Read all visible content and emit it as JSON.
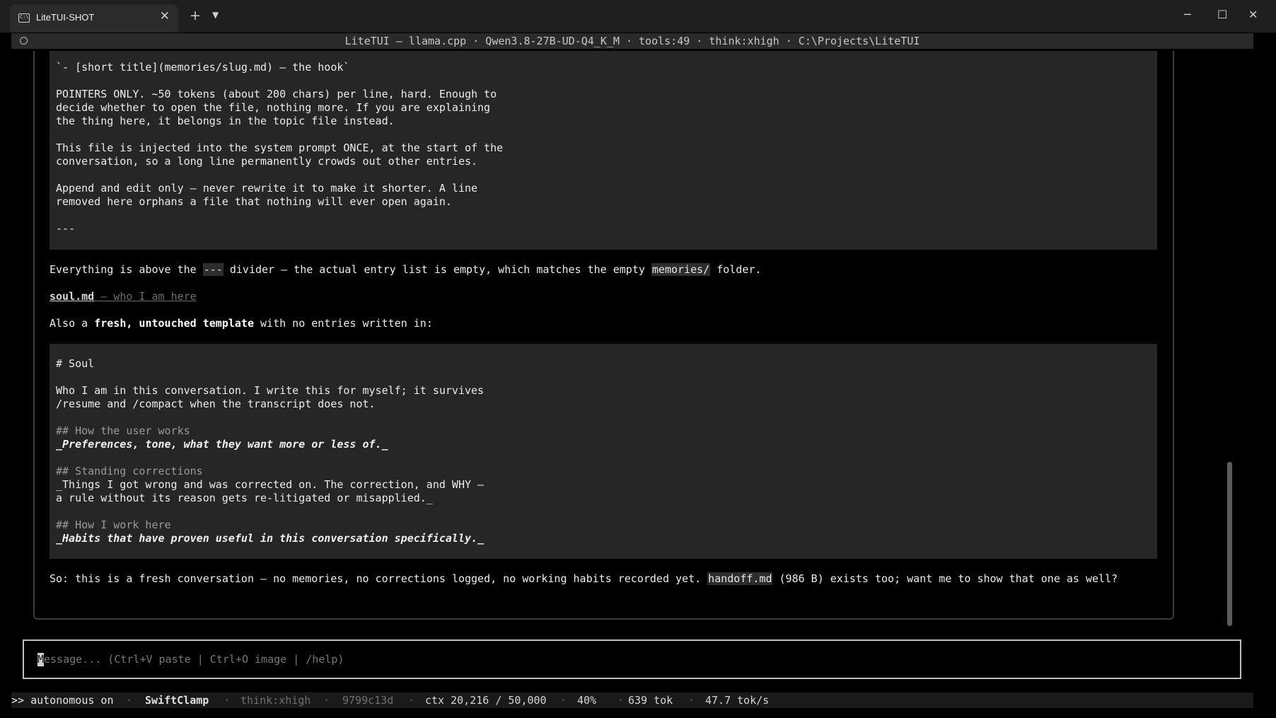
{
  "window": {
    "tab_title": "LiteTUI-SHOT",
    "tab_icon": "terminal-icon",
    "new_tab_label": "+",
    "tab_dropdown_label": "⌄",
    "close_tab_label": "✕",
    "minimize_label": "─",
    "maximize_label": "☐",
    "close_label": "✕"
  },
  "titlebar": {
    "text": "LiteTUI — llama.cpp · Qwen3.8-27B-UD-Q4_K_M · tools:49 · think:xhigh · C:\\Projects\\LiteTUI"
  },
  "transcript": {
    "block1": [
      "`- [short title](memories/slug.md) — the hook`",
      "",
      "POINTERS ONLY. ~50 tokens (about 200 chars) per line, hard. Enough to",
      "decide whether to open the file, nothing more. If you are explaining",
      "the thing here, it belongs in the topic file instead.",
      "",
      "This file is injected into the system prompt ONCE, at the start of the",
      "conversation, so a long line permanently crowds out other entries.",
      "",
      "Append and edit only — never rewrite it to make it shorter. A line",
      "removed here orphans a file that nothing will ever open again.",
      "",
      "---"
    ],
    "para1": {
      "pre": "Everything is above the ",
      "code": "---",
      "mid": " divider — the actual entry list is empty, which matches the empty ",
      "code2": "memories/",
      "post": " folder."
    },
    "file_link": {
      "name": "soul.md",
      "desc": " — who I am here"
    },
    "para2": {
      "pre": "Also a ",
      "bold": "fresh, untouched template",
      "post": " with no entries written in:"
    },
    "block2": {
      "heading": "# Soul",
      "intro1": "Who I am in this conversation. I write this for myself; it survives",
      "intro2": "/resume and /compact when the transcript does not.",
      "h1": "## How the user works",
      "h1_body": "_Preferences, tone, what they want more or less of._",
      "h2": "## Standing corrections",
      "h2_body1": "_Things I got wrong and was corrected on. The correction, and WHY —",
      "h2_body2": "a rule without its reason gets re-litigated or misapplied._",
      "h3": "## How I work here",
      "h3_body": "_Habits that have proven useful in this conversation specifically._"
    },
    "para3": {
      "pre": "So: this is a fresh conversation — no memories, no corrections logged, no working habits recorded yet. ",
      "code": "handoff.md",
      "post": " (986 B) exists too; want me to show that one as well?"
    }
  },
  "input": {
    "cursor_char": "M",
    "placeholder": "essage... (Ctrl+V paste | Ctrl+O image | /help)"
  },
  "status": {
    "mode": ">> autonomous on",
    "name": "SwiftClamp",
    "think": "think:xhigh",
    "hash": "9799c13d",
    "ctx": "ctx 20,216 / 50,000",
    "pct": "40%",
    "tok": "639 tok",
    "rate": "47.7 tok/s",
    "sep": "·"
  }
}
